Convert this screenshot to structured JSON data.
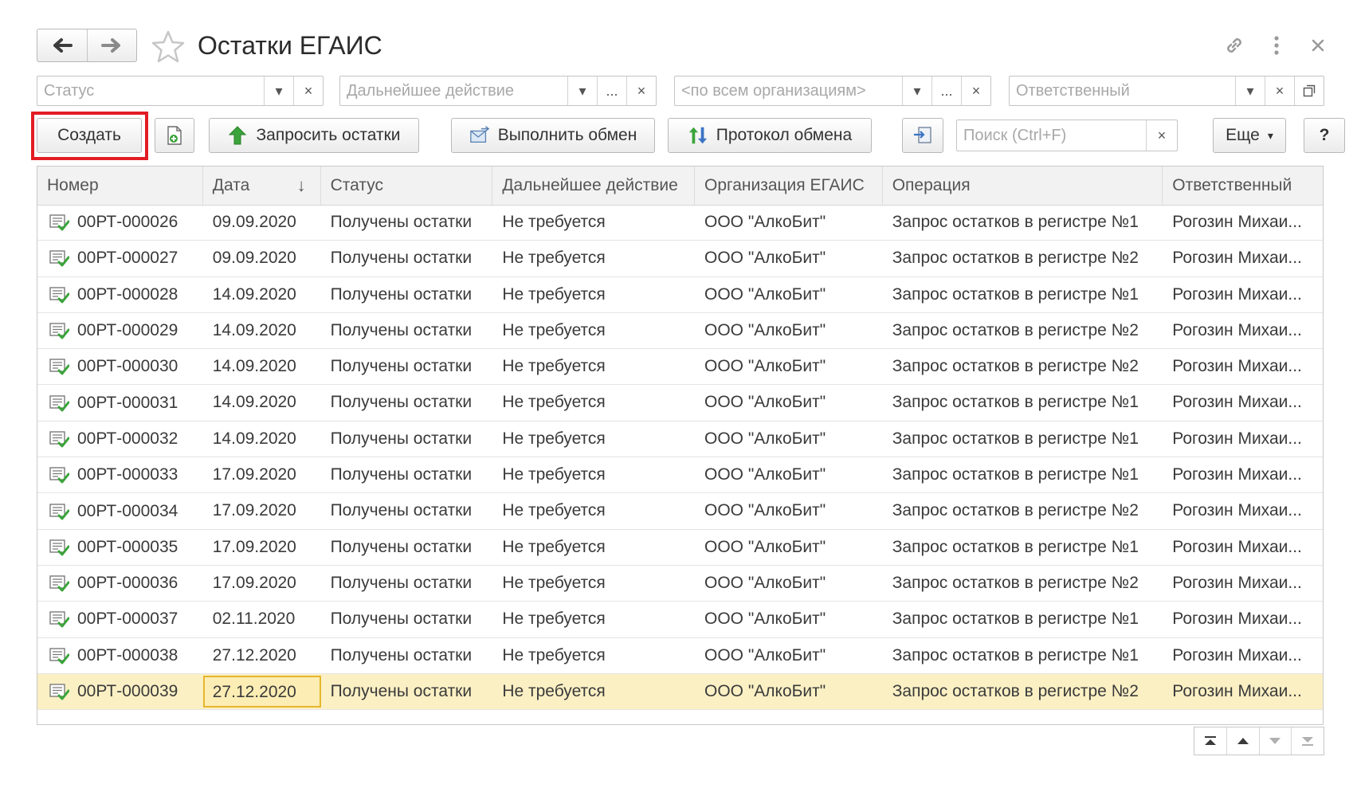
{
  "window": {
    "title": "Остатки ЕГАИС"
  },
  "filters": {
    "status_placeholder": "Статус",
    "next_action_placeholder": "Дальнейшее действие",
    "organization_placeholder": "<по всем организациям>",
    "responsible_placeholder": "Ответственный",
    "ellipsis": "...",
    "clear": "×"
  },
  "toolbar": {
    "create_label": "Создать",
    "request_label": "Запросить остатки",
    "exchange_label": "Выполнить обмен",
    "protocol_label": "Протокол обмена",
    "search_placeholder": "Поиск (Ctrl+F)",
    "search_clear": "×",
    "more_label": "Еще",
    "help_label": "?"
  },
  "table": {
    "columns": [
      "Номер",
      "Дата",
      "Статус",
      "Дальнейшее действие",
      "Организация ЕГАИС",
      "Операция",
      "Ответственный"
    ],
    "sort_indicator": "↓",
    "rows": [
      [
        "00РТ-000026",
        "09.09.2020",
        "Получены остатки",
        "Не требуется",
        "ООО \"АлкоБит\"",
        "Запрос остатков в регистре №1",
        "Рогозин Михаи..."
      ],
      [
        "00РТ-000027",
        "09.09.2020",
        "Получены остатки",
        "Не требуется",
        "ООО \"АлкоБит\"",
        "Запрос остатков в регистре №2",
        "Рогозин Михаи..."
      ],
      [
        "00РТ-000028",
        "14.09.2020",
        "Получены остатки",
        "Не требуется",
        "ООО \"АлкоБит\"",
        "Запрос остатков в регистре №1",
        "Рогозин Михаи..."
      ],
      [
        "00РТ-000029",
        "14.09.2020",
        "Получены остатки",
        "Не требуется",
        "ООО \"АлкоБит\"",
        "Запрос остатков в регистре №2",
        "Рогозин Михаи..."
      ],
      [
        "00РТ-000030",
        "14.09.2020",
        "Получены остатки",
        "Не требуется",
        "ООО \"АлкоБит\"",
        "Запрос остатков в регистре №2",
        "Рогозин Михаи..."
      ],
      [
        "00РТ-000031",
        "14.09.2020",
        "Получены остатки",
        "Не требуется",
        "ООО \"АлкоБит\"",
        "Запрос остатков в регистре №1",
        "Рогозин Михаи..."
      ],
      [
        "00РТ-000032",
        "14.09.2020",
        "Получены остатки",
        "Не требуется",
        "ООО \"АлкоБит\"",
        "Запрос остатков в регистре №1",
        "Рогозин Михаи..."
      ],
      [
        "00РТ-000033",
        "17.09.2020",
        "Получены остатки",
        "Не требуется",
        "ООО \"АлкоБит\"",
        "Запрос остатков в регистре №1",
        "Рогозин Михаи..."
      ],
      [
        "00РТ-000034",
        "17.09.2020",
        "Получены остатки",
        "Не требуется",
        "ООО \"АлкоБит\"",
        "Запрос остатков в регистре №2",
        "Рогозин Михаи..."
      ],
      [
        "00РТ-000035",
        "17.09.2020",
        "Получены остатки",
        "Не требуется",
        "ООО \"АлкоБит\"",
        "Запрос остатков в регистре №1",
        "Рогозин Михаи..."
      ],
      [
        "00РТ-000036",
        "17.09.2020",
        "Получены остатки",
        "Не требуется",
        "ООО \"АлкоБит\"",
        "Запрос остатков в регистре №2",
        "Рогозин Михаи..."
      ],
      [
        "00РТ-000037",
        "02.11.2020",
        "Получены остатки",
        "Не требуется",
        "ООО \"АлкоБит\"",
        "Запрос остатков в регистре №1",
        "Рогозин Михаи..."
      ],
      [
        "00РТ-000038",
        "27.12.2020",
        "Получены остатки",
        "Не требуется",
        "ООО \"АлкоБит\"",
        "Запрос остатков в регистре №1",
        "Рогозин Михаи..."
      ],
      [
        "00РТ-000039",
        "27.12.2020",
        "Получены остатки",
        "Не требуется",
        "ООО \"АлкоБит\"",
        "Запрос остатков в регистре №2",
        "Рогозин Михаи..."
      ]
    ],
    "selected_row": 13
  },
  "colors": {
    "highlight_frame": "#e21c24",
    "selected_row": "#fbf0c4",
    "selected_cell_border": "#e6b52c",
    "icon_green": "#3aa43a"
  },
  "icons": {
    "back": "arrow-left-icon",
    "forward": "arrow-right-icon",
    "favorite": "star-icon",
    "link": "link-icon",
    "menu": "kebab-menu-icon",
    "close": "close-icon",
    "row_document": "posted-document-icon"
  }
}
